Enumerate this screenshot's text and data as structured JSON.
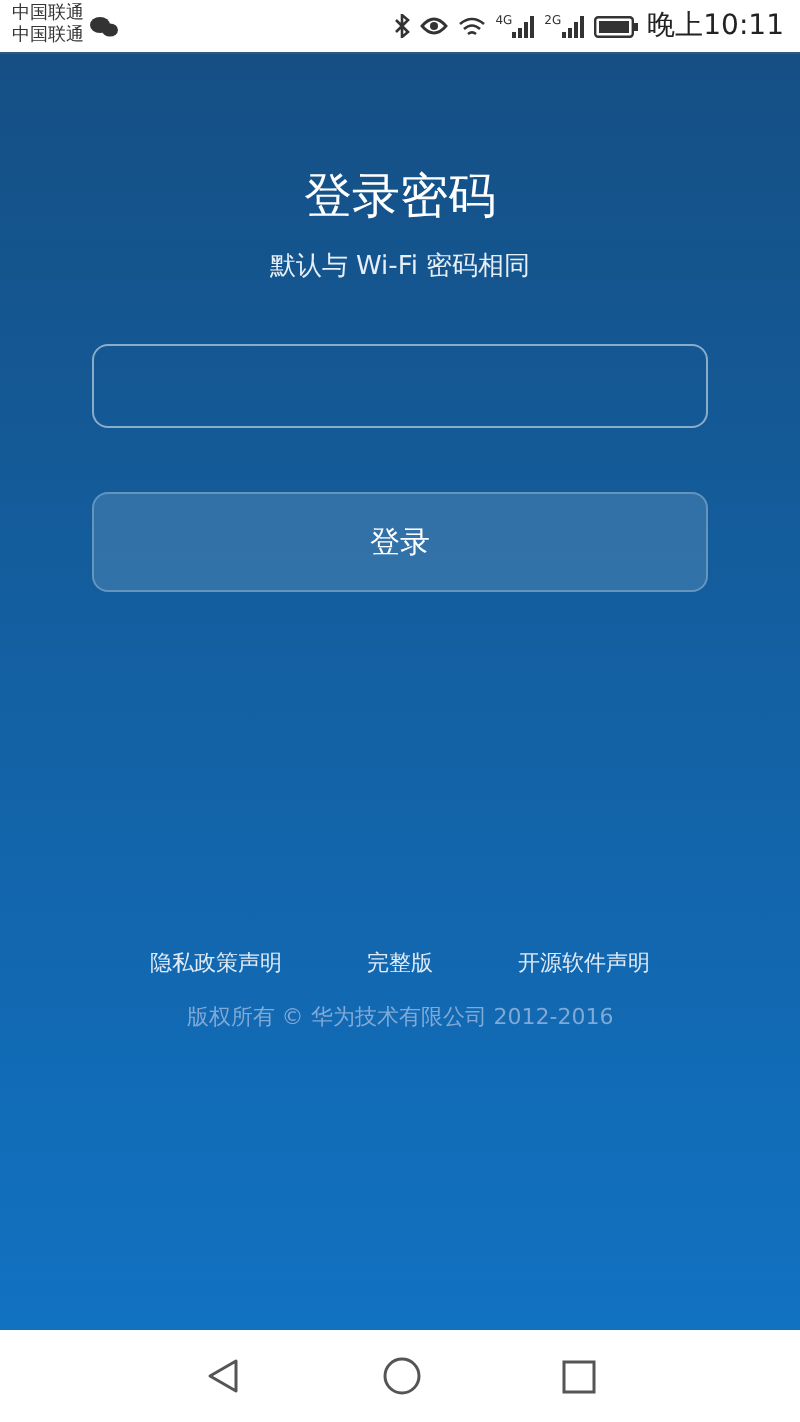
{
  "status_bar": {
    "carriers": [
      "中国联通",
      "中国联通"
    ],
    "signals": [
      {
        "network": "4G"
      },
      {
        "network": "2G"
      }
    ],
    "time": "晚上10:11"
  },
  "login": {
    "title": "登录密码",
    "subtitle": "默认与 Wi-Fi 密码相同",
    "button": "登录"
  },
  "footer": {
    "links": [
      "隐私政策声明",
      "完整版",
      "开源软件声明"
    ],
    "copyright": "版权所有 © 华为技术有限公司 2012-2016"
  }
}
